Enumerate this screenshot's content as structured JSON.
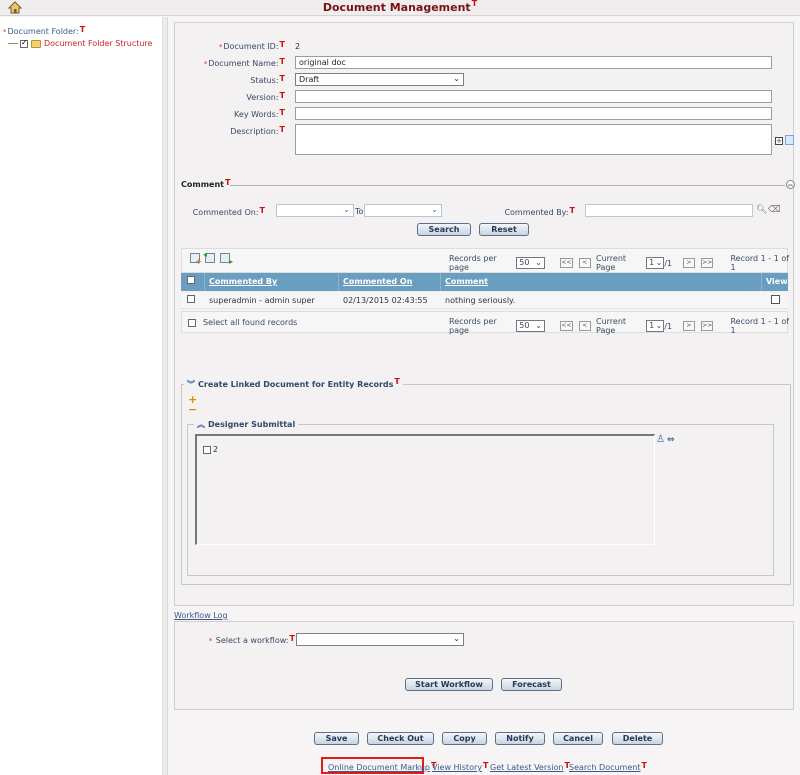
{
  "header": {
    "title": "Document Management",
    "t_marker": "T",
    "home_icon": "home-icon"
  },
  "left_panel": {
    "label": "Document Folder:",
    "required_marker": "*",
    "t_marker": "T",
    "tree": [
      {
        "label": "Document Folder Structure",
        "checked": true,
        "icon": "folder-icon"
      }
    ]
  },
  "form": {
    "document_id": {
      "label": "Document ID:",
      "value": "2",
      "required": true
    },
    "document_name": {
      "label": "Document Name:",
      "value": "original doc",
      "required": true
    },
    "status": {
      "label": "Status:",
      "value": "Draft"
    },
    "version": {
      "label": "Version:",
      "value": ""
    },
    "key_words": {
      "label": "Key Words:",
      "value": ""
    },
    "description": {
      "label": "Description:",
      "value": ""
    },
    "t_marker": "T",
    "req_marker": "*"
  },
  "comment": {
    "title": "Comment",
    "commented_on_label": "Commented On:",
    "to_label": "To",
    "commented_by_label": "Commented By:",
    "commented_on_from": "",
    "commented_on_to": "",
    "commented_by": "",
    "search_button": "Search",
    "reset_button": "Reset",
    "pager": {
      "records_per_page_label": "Records per page",
      "records_per_page": "50",
      "first": "<<",
      "prev": "<",
      "next": ">",
      "last": ">>",
      "current_page_label": "Current Page",
      "current_page": "1",
      "total_pages": "/1",
      "record_info": "Record 1 - 1 of 1"
    },
    "columns": [
      "Commented By",
      "Commented On",
      "Comment",
      "View"
    ],
    "rows": [
      {
        "commented_by": "superadmin - admin super",
        "commented_on": "02/13/2015 02:43:55 PM",
        "comment": "nothing seriously."
      }
    ],
    "select_all_label": "Select all found records"
  },
  "linked": {
    "title": "Create Linked Document for Entity Records",
    "sub_title": "Designer Submittal",
    "items": [
      {
        "label": "2",
        "checked": false
      }
    ]
  },
  "workflow": {
    "log_link": "Workflow Log",
    "select_label": "Select a workflow:",
    "select_value": "",
    "start_button": "Start Workflow",
    "forecast_button": "Forecast"
  },
  "actions": [
    "Save",
    "Check Out",
    "Copy",
    "Notify",
    "Cancel",
    "Delete"
  ],
  "links": [
    "Online Document Markup",
    "View History",
    "Get Latest Version",
    "Search Document"
  ]
}
